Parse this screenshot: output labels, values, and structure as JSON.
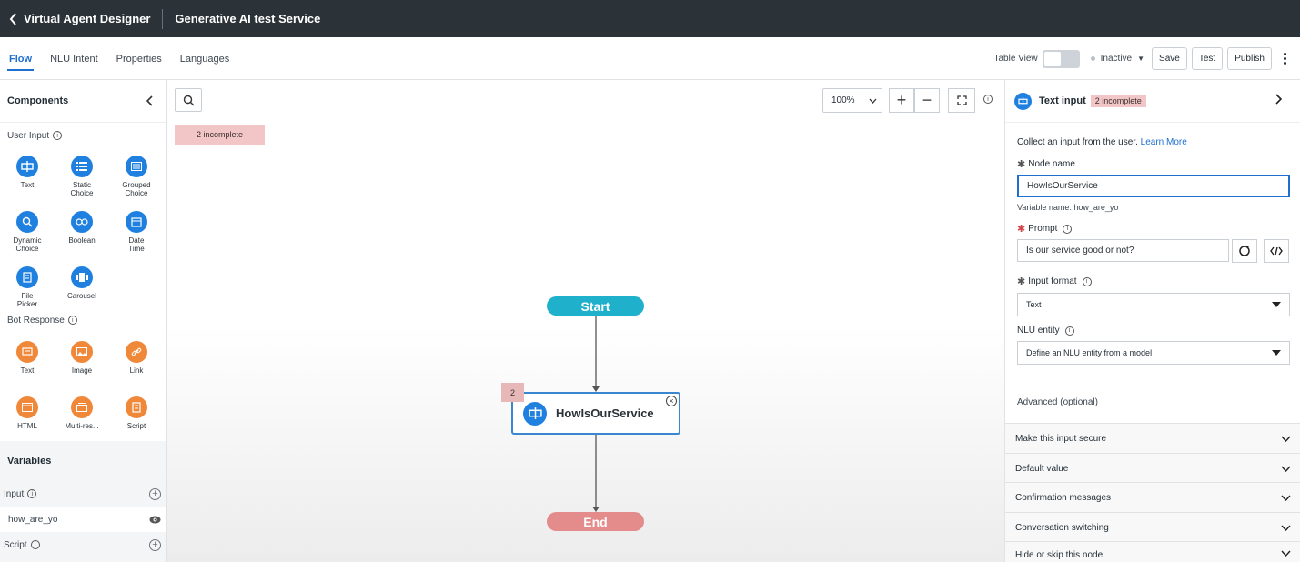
{
  "topbar": {
    "app_title": "Virtual Agent Designer",
    "doc_title": "Generative AI test Service"
  },
  "tabs": [
    {
      "label": "Flow",
      "active": true
    },
    {
      "label": "NLU Intent",
      "active": false
    },
    {
      "label": "Properties",
      "active": false
    },
    {
      "label": "Languages",
      "active": false
    }
  ],
  "toolbar": {
    "table_view_label": "Table View",
    "table_view_on": false,
    "status": "Inactive",
    "save_label": "Save",
    "test_label": "Test",
    "publish_label": "Publish"
  },
  "sidebar": {
    "title": "Components",
    "user_input_label": "User Input",
    "user_input_items": [
      "Text",
      "Static\nChoice",
      "Grouped\nChoice",
      "Dynamic\nChoice",
      "Boolean",
      "Date\nTime",
      "File\nPicker",
      "Carousel"
    ],
    "bot_response_label": "Bot Response",
    "bot_response_items": [
      "Text",
      "Image",
      "Link",
      "HTML",
      "Multi-res...",
      "Script"
    ],
    "variables_title": "Variables",
    "input_label": "Input",
    "input_var": "how_are_yo",
    "script_label": "Script"
  },
  "canvas": {
    "incomplete_label": "2 incomplete",
    "zoom": "100%",
    "start_label": "Start",
    "end_label": "End",
    "node_name": "HowIsOurService",
    "node_badge": "2"
  },
  "panel": {
    "title": "Text input",
    "badge": "2 incomplete",
    "description": "Collect an input from the user.",
    "learn_more": "Learn More",
    "node_name_label": "Node name",
    "node_name_value": "HowIsOurService",
    "variable_name": "Variable name: how_are_yo",
    "prompt_label": "Prompt",
    "prompt_value": "Is our service good or not?",
    "input_format_label": "Input format",
    "input_format_value": "Text",
    "nlu_entity_label": "NLU entity",
    "nlu_entity_value": "Define an NLU entity from a model",
    "advanced_label": "Advanced (optional)",
    "sections": [
      "Make this input secure",
      "Default value",
      "Confirmation messages",
      "Conversation switching",
      "Hide or skip this node"
    ]
  },
  "colors": {
    "topbar": "#2b3238",
    "accent": "#1f6fd1",
    "start": "#1fb0cc",
    "end": "#e48b8b",
    "incomplete": "#f2c6c6"
  }
}
